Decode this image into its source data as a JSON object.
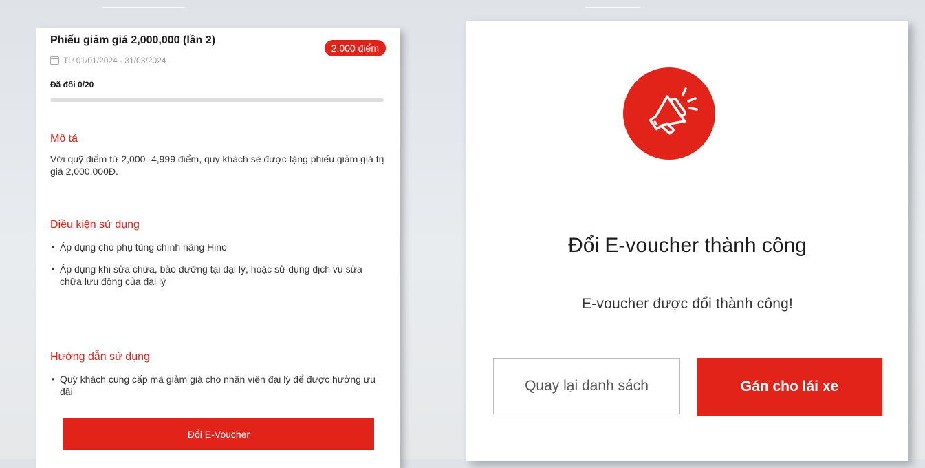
{
  "voucher": {
    "title": "Phiếu giảm giá 2,000,000 (lần 2)",
    "points_badge": "2.000 điểm",
    "date_range": "Từ 01/01/2024 - 31/03/2024",
    "redeemed_text": "Đã đổi 0/20",
    "redeemed_fraction": 0
  },
  "description": {
    "title": "Mô tả",
    "text": "Với quỹ điểm từ 2,000 -4,999 điểm, quý khách sẽ được tặng phiếu giảm giá trị giá 2,000,000Đ."
  },
  "conditions": {
    "title": "Điều kiện sử dụng",
    "items": [
      "Áp dụng cho phụ tùng chính hãng Hino",
      "Áp dụng khi sửa chữa, bảo dưỡng tại đại lý, hoặc sử dụng dịch vụ sửa chữa lưu động của đại lý"
    ]
  },
  "instructions": {
    "title": "Hướng dẫn sử dụng",
    "items": [
      "Quý khách cung cấp mã giảm giá cho nhân viên đại lý để được hưởng ưu đãi"
    ]
  },
  "redeem_button_label": "Đổi E-Voucher",
  "success": {
    "icon": "megaphone-icon",
    "title": "Đổi E-voucher thành công",
    "subtitle": "E-voucher được đổi thành công!",
    "back_label": "Quay lại danh sách",
    "assign_label": "Gán cho lái xe"
  },
  "colors": {
    "accent": "#e2231a"
  }
}
